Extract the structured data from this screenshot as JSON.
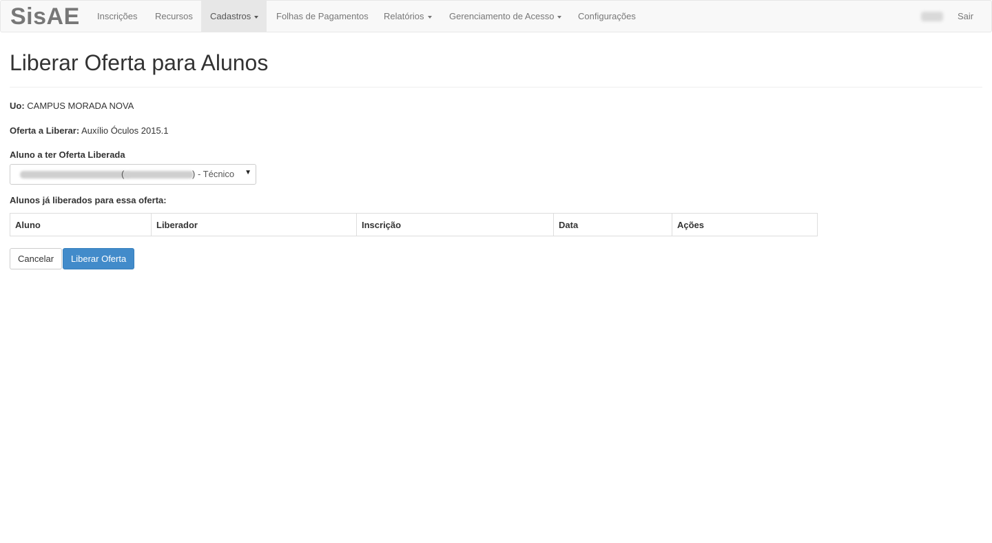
{
  "navbar": {
    "brand": "SisAE",
    "items": [
      {
        "label": "Inscrições"
      },
      {
        "label": "Recursos"
      },
      {
        "label": "Cadastros"
      },
      {
        "label": "Folhas de Pagamentos"
      },
      {
        "label": "Relatórios"
      },
      {
        "label": "Gerenciamento de Acesso"
      },
      {
        "label": "Configurações"
      }
    ],
    "logout": "Sair"
  },
  "page": {
    "title": "Liberar Oferta para Alunos",
    "uo_label": "Uo:",
    "uo_value": "CAMPUS MORADA NOVA",
    "oferta_label": "Oferta a Liberar:",
    "oferta_value": "Auxílio Óculos 2015.1",
    "aluno_label": "Aluno a ter Oferta Liberada",
    "aluno_select": {
      "open_paren": "(",
      "selected_suffix": ") - Técnico ("
    },
    "liberados_label": "Alunos já liberados para essa oferta:"
  },
  "table": {
    "headers": [
      "Aluno",
      "Liberador",
      "Inscrição",
      "Data",
      "Ações"
    ]
  },
  "buttons": {
    "cancel": "Cancelar",
    "submit": "Liberar Oferta"
  },
  "colors": {
    "primary": "#428bca",
    "navbar_bg": "#f8f8f8",
    "active_tab": "#e7e7e7"
  }
}
